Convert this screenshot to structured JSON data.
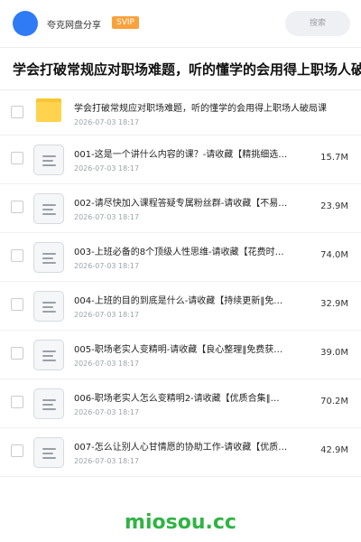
{
  "header": {
    "app_name": "夸克网盘分享",
    "badge": "SVIP",
    "search_placeholder": "搜索",
    "avatar_color": "#2f7bf6",
    "badge_color": "#f9a23b"
  },
  "page_title": "学会打破常规应对职场难题，听的懂学的会用得上职场人破",
  "files": [
    {
      "type": "folder",
      "name": "学会打破常规应对职场难题，听的懂学的会用得上职场人破局课",
      "date": "2026-07-03 18:17",
      "size": ""
    },
    {
      "type": "file",
      "name": "001-这是一个讲什么内容的课？-请收藏【精挑细选…",
      "date": "2026-07-03 18:17",
      "size": "15.7M"
    },
    {
      "type": "file",
      "name": "002-请尽快加入课程答疑专属粉丝群-请收藏【不易…",
      "date": "2026-07-03 18:17",
      "size": "23.9M"
    },
    {
      "type": "file",
      "name": "003-上班必备的8个顶级人性思维-请收藏【花费时…",
      "date": "2026-07-03 18:17",
      "size": "74.0M"
    },
    {
      "type": "file",
      "name": "004-上班的目的到底是什么-请收藏【持续更新‖免…",
      "date": "2026-07-03 18:17",
      "size": "32.9M"
    },
    {
      "type": "file",
      "name": "005-职场老实人变精明-请收藏【良心整理‖免费获…",
      "date": "2026-07-03 18:17",
      "size": "39.0M"
    },
    {
      "type": "file",
      "name": "006-职场老实人怎么变精明2-请收藏【优质合集‖…",
      "date": "2026-07-03 18:17",
      "size": "70.2M"
    },
    {
      "type": "file",
      "name": "007-怎么让别人心甘情愿的协助工作-请收藏【优质…",
      "date": "2026-07-03 18:17",
      "size": "42.9M"
    }
  ],
  "watermark": "miosou.cc",
  "watermark_color": "#31b344"
}
